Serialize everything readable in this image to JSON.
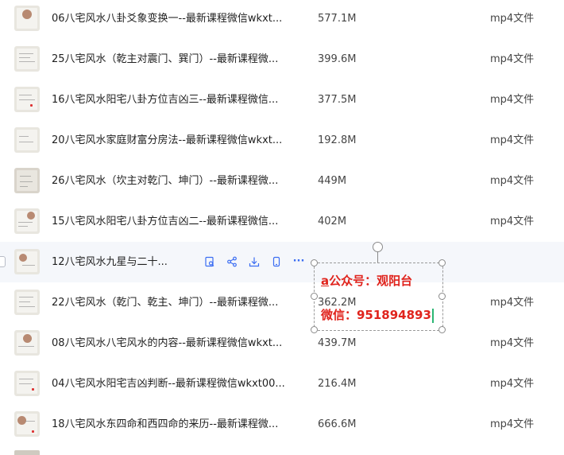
{
  "files": [
    {
      "name": "06八宅风水八卦爻象变换一--最新课程微信wkxt...",
      "size": "577.1M",
      "type": "mp4文件"
    },
    {
      "name": "25八宅风水（乾主对震门、巽门）--最新课程微...",
      "size": "399.6M",
      "type": "mp4文件"
    },
    {
      "name": "16八宅风水阳宅八卦方位吉凶三--最新课程微信...",
      "size": "377.5M",
      "type": "mp4文件"
    },
    {
      "name": "20八宅风水家庭财富分房法--最新课程微信wkxt...",
      "size": "192.8M",
      "type": "mp4文件"
    },
    {
      "name": "26八宅风水（坎主对乾门、坤门）--最新课程微...",
      "size": "449M",
      "type": "mp4文件"
    },
    {
      "name": "15八宅风水阳宅八卦方位吉凶二--最新课程微信...",
      "size": "402M",
      "type": "mp4文件"
    },
    {
      "name": "12八宅风水九星与二十...",
      "size": "",
      "type": ""
    },
    {
      "name": "22八宅风水（乾门、乾主、坤门）--最新课程微...",
      "size": "362.2M",
      "type": "mp4文件"
    },
    {
      "name": "08八宅风水八宅风水的内容--最新课程微信wkxt...",
      "size": "439.7M",
      "type": "mp4文件"
    },
    {
      "name": "04八宅风水阳宅吉凶判断--最新课程微信wkxt00...",
      "size": "216.4M",
      "type": "mp4文件"
    },
    {
      "name": "18八宅风水东四命和西四命的来历--最新课程微...",
      "size": "666.6M",
      "type": "mp4文件"
    }
  ],
  "row_actions": [
    "preview-icon",
    "share-icon",
    "download-icon",
    "phone-icon",
    "more-icon"
  ],
  "row_actions_more": "···",
  "overlay": {
    "line1_prefix": "a",
    "line1_rest": "公众号：观阳台",
    "line2": "微信：951894893"
  },
  "colors": {
    "accent": "#3b6df2",
    "overlay_text": "#e0241d",
    "hover_row": "#f5f7fb"
  }
}
